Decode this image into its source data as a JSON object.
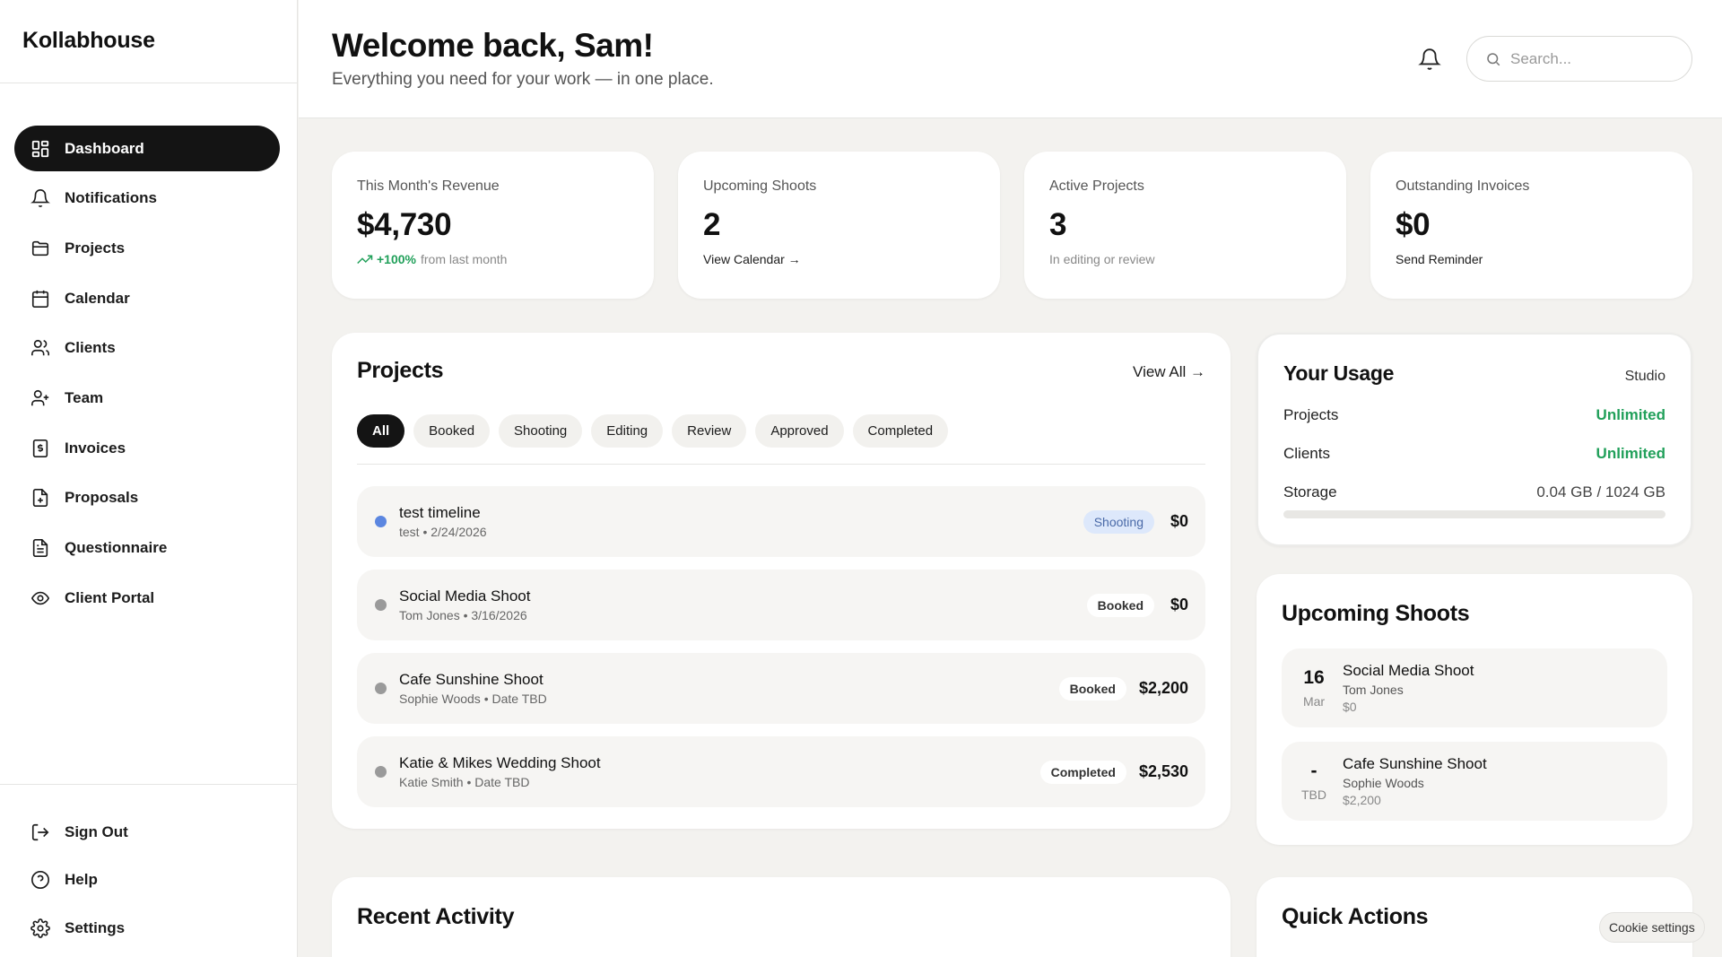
{
  "app": {
    "name": "Kollabhouse"
  },
  "sidebar": {
    "items": [
      {
        "label": "Dashboard",
        "icon": "dashboard-icon"
      },
      {
        "label": "Notifications",
        "icon": "bell-icon"
      },
      {
        "label": "Projects",
        "icon": "folder-icon"
      },
      {
        "label": "Calendar",
        "icon": "calendar-icon"
      },
      {
        "label": "Clients",
        "icon": "users-icon"
      },
      {
        "label": "Team",
        "icon": "user-plus-icon"
      },
      {
        "label": "Invoices",
        "icon": "invoice-icon"
      },
      {
        "label": "Proposals",
        "icon": "file-plus-icon"
      },
      {
        "label": "Questionnaire",
        "icon": "document-icon"
      },
      {
        "label": "Client Portal",
        "icon": "eye-icon"
      }
    ],
    "bottom": [
      {
        "label": "Sign Out",
        "icon": "sign-out-icon"
      },
      {
        "label": "Help",
        "icon": "help-icon"
      },
      {
        "label": "Settings",
        "icon": "gear-icon"
      }
    ]
  },
  "header": {
    "title": "Welcome back, Sam!",
    "subtitle": "Everything you need for your work — in one place.",
    "search_placeholder": "Search..."
  },
  "stats": [
    {
      "label": "This Month's Revenue",
      "value": "$4,730",
      "trend": "+100%",
      "foot": "from last month"
    },
    {
      "label": "Upcoming Shoots",
      "value": "2",
      "foot": "View Calendar →"
    },
    {
      "label": "Active Projects",
      "value": "3",
      "foot": "In editing or review"
    },
    {
      "label": "Outstanding Invoices",
      "value": "$0",
      "foot": "Send Reminder"
    }
  ],
  "projects": {
    "title": "Projects",
    "view_all": "View All →",
    "filters": [
      "All",
      "Booked",
      "Shooting",
      "Editing",
      "Review",
      "Approved",
      "Completed"
    ],
    "active_filter": "All",
    "rows": [
      {
        "name": "test timeline",
        "meta": "test • 2/24/2026",
        "status": "Shooting",
        "amount": "$0"
      },
      {
        "name": "Social Media Shoot",
        "meta": "Tom Jones • 3/16/2026",
        "status": "Booked",
        "amount": "$0"
      },
      {
        "name": "Cafe Sunshine Shoot",
        "meta": "Sophie Woods • Date TBD",
        "status": "Booked",
        "amount": "$2,200"
      },
      {
        "name": "Katie & Mikes Wedding Shoot",
        "meta": "Katie Smith • Date TBD",
        "status": "Completed",
        "amount": "$2,530"
      }
    ]
  },
  "usage": {
    "title": "Your Usage",
    "plan": "Studio",
    "projects_label": "Projects",
    "projects_value": "Unlimited",
    "clients_label": "Clients",
    "clients_value": "Unlimited",
    "storage_label": "Storage",
    "storage_value": "0.04 GB / 1024 GB",
    "storage_fraction": 4e-05
  },
  "shoots": {
    "title": "Upcoming Shoots",
    "rows": [
      {
        "day": "16",
        "month": "Mar",
        "name": "Social Media Shoot",
        "client": "Tom Jones",
        "amount": "$0"
      },
      {
        "day": "-",
        "month": "TBD",
        "name": "Cafe Sunshine Shoot",
        "client": "Sophie Woods",
        "amount": "$2,200"
      }
    ]
  },
  "activity": {
    "title": "Recent Activity"
  },
  "quick": {
    "title": "Quick Actions"
  },
  "cookie": {
    "label": "Cookie settings"
  },
  "colors": {
    "accent": "#141414",
    "green": "#21a05a",
    "blue_dot": "#5b86e0"
  }
}
